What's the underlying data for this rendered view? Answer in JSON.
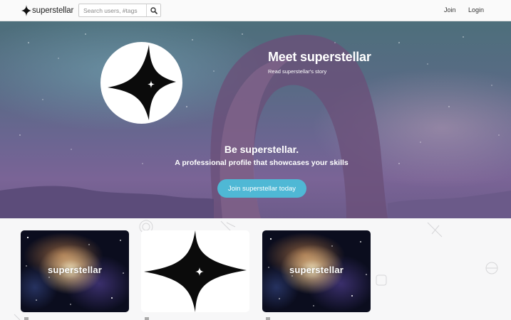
{
  "navbar": {
    "brand": "superstellar",
    "brand_icon": "star-icon",
    "search_placeholder": "Search users, #tags",
    "search_icon": "search-icon",
    "join_label": "Join",
    "login_label": "Login"
  },
  "hero": {
    "meet_title": "Meet superstellar",
    "meet_subtitle": "Read superstellar's story",
    "be_title": "Be superstellar.",
    "be_subtitle": "A professional profile that showcases your skills",
    "cta_label": "Join superstellar today"
  },
  "cards": [
    {
      "label": "superstellar",
      "style": "space-image"
    },
    {
      "label": "",
      "style": "star-logo"
    },
    {
      "label": "superstellar",
      "style": "space-image"
    }
  ],
  "colors": {
    "cta": "#4fb8d5",
    "navbar_bg": "#fafafa",
    "page_bg": "#f7f7f8"
  }
}
